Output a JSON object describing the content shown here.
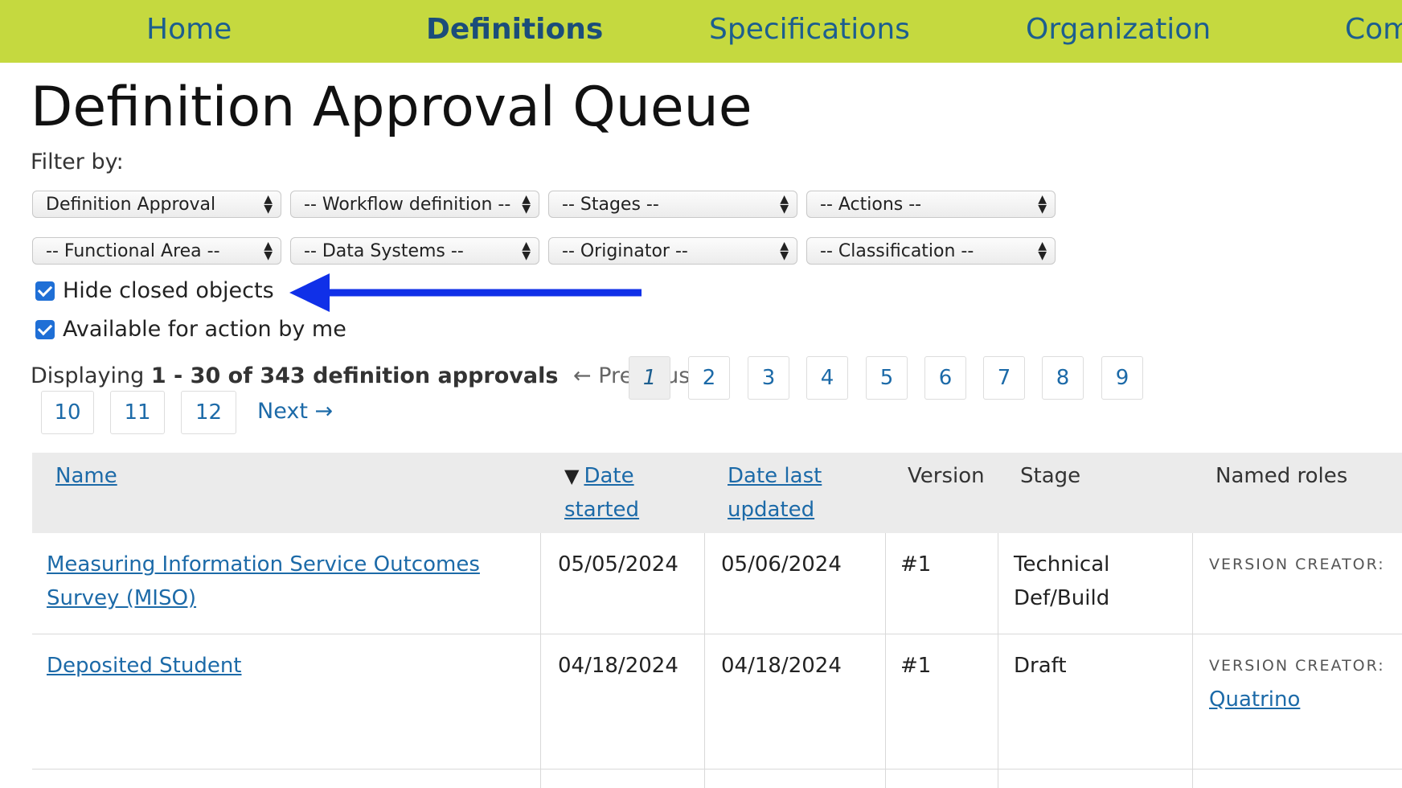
{
  "nav": {
    "items": [
      {
        "label": "Home",
        "active": false
      },
      {
        "label": "Definitions",
        "active": true
      },
      {
        "label": "Specifications",
        "active": false
      },
      {
        "label": "Organization",
        "active": false
      },
      {
        "label": "Com",
        "active": false
      }
    ],
    "bg_color": "#c5d93f"
  },
  "page_title": "Definition Approval Queue",
  "filter": {
    "label": "Filter by:",
    "selects": [
      "Definition Approval",
      "-- Workflow definition --",
      "-- Stages --",
      "-- Actions --",
      "-- Functional Area --",
      "-- Data Systems --",
      "-- Originator --",
      "-- Classification --"
    ],
    "checkboxes": [
      {
        "label": "Hide closed objects",
        "checked": true
      },
      {
        "label": "Available for action by me",
        "checked": true
      }
    ]
  },
  "annotation": {
    "icon": "arrow-left-icon",
    "color": "#1030e8"
  },
  "pagination": {
    "prefix": "Displaying",
    "range": "1 - 30 of 343 definition approvals",
    "previous": "← Previous",
    "pages": [
      "1",
      "2",
      "3",
      "4",
      "5",
      "6",
      "7",
      "8",
      "9",
      "10",
      "11",
      "12"
    ],
    "current": "1",
    "next": "Next →"
  },
  "table": {
    "headers": {
      "name": "Name",
      "date_started_1": "Date",
      "date_started_2": "started",
      "date_updated_1": "Date last",
      "date_updated_2": "updated",
      "version": "Version",
      "stage": "Stage",
      "roles": "Named roles"
    },
    "rows": [
      {
        "name_1": "Measuring Information Service Outcomes",
        "name_2": "Survey (MISO)",
        "date_started": "05/05/2024",
        "date_updated": "05/06/2024",
        "version": "#1",
        "stage_1": "Technical",
        "stage_2": "Def/Build",
        "role_label": "VERSION CREATOR:",
        "role_name": ""
      },
      {
        "name_1": "Deposited Student",
        "name_2": "",
        "date_started": "04/18/2024",
        "date_updated": "04/18/2024",
        "version": "#1",
        "stage_1": "Draft",
        "stage_2": "",
        "role_label": "VERSION CREATOR:",
        "role_name": "Quatrino"
      }
    ]
  }
}
